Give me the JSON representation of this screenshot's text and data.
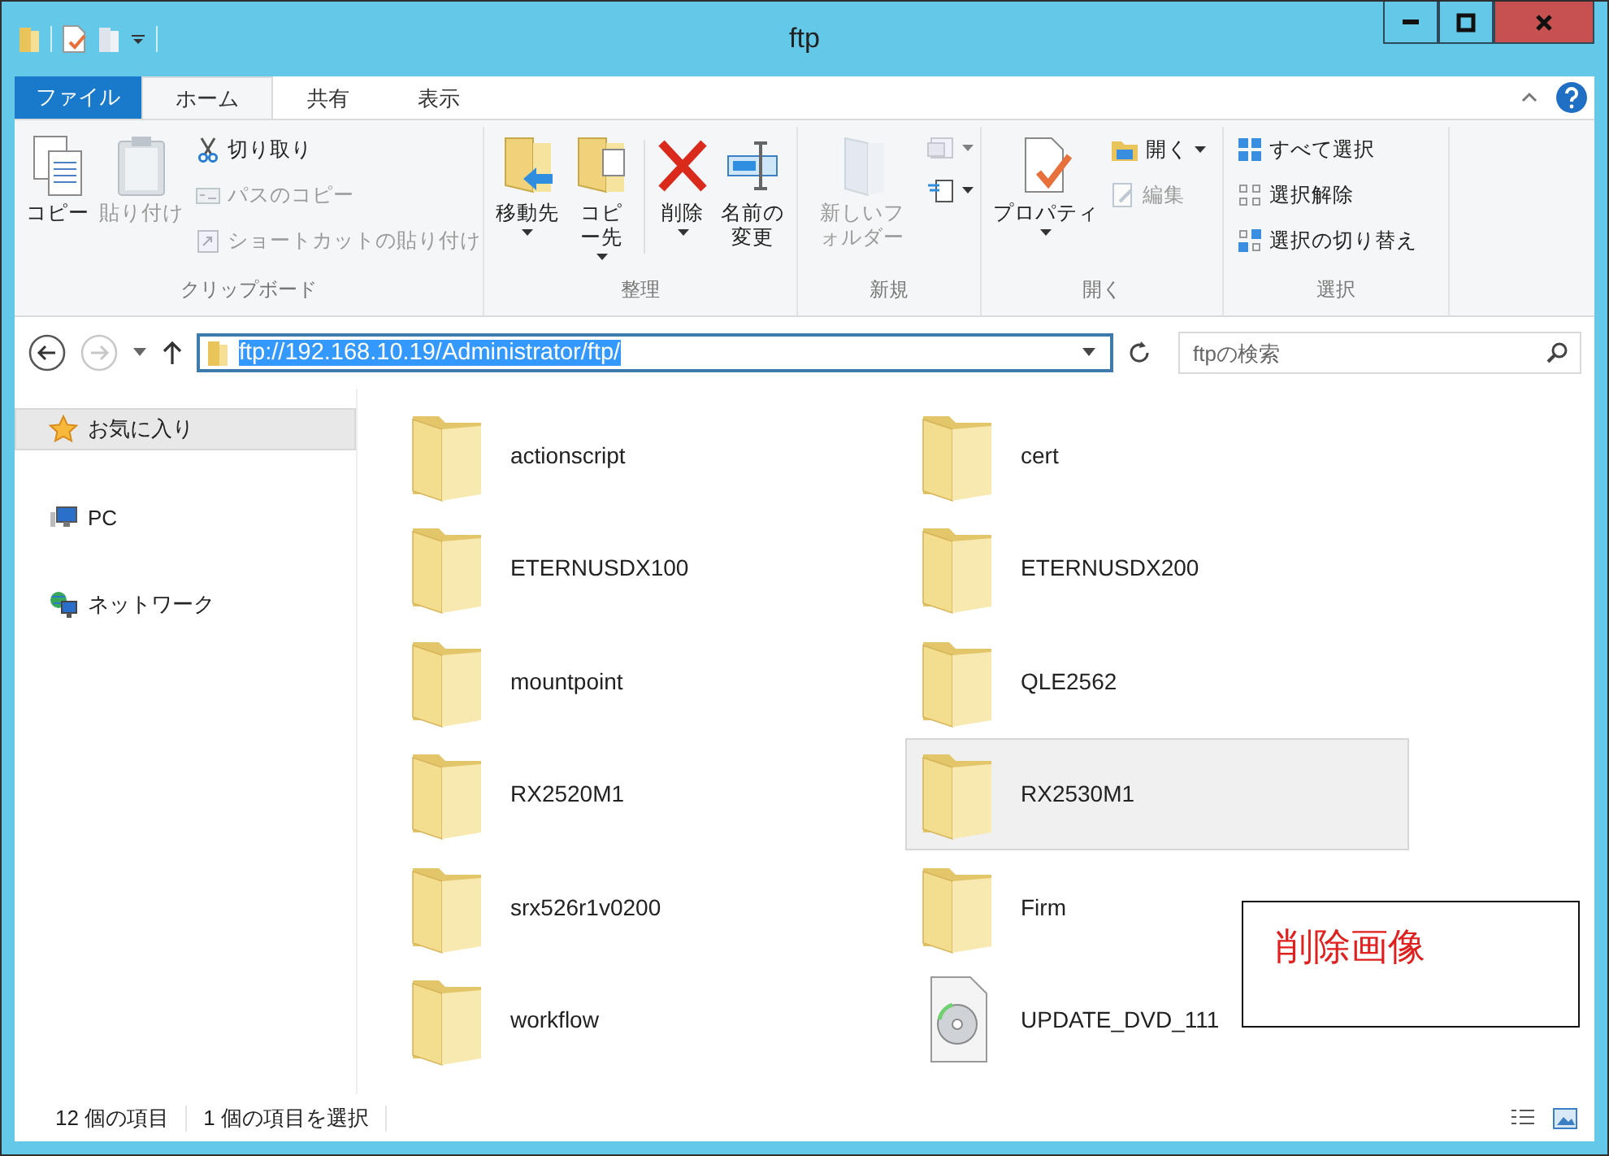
{
  "window": {
    "title": "ftp"
  },
  "ribbon_tabs": [
    {
      "label": "ファイル",
      "kind": "file",
      "selected": false
    },
    {
      "label": "ホーム",
      "kind": "tab",
      "selected": true
    },
    {
      "label": "共有",
      "kind": "tab",
      "selected": false
    },
    {
      "label": "表示",
      "kind": "tab",
      "selected": false
    }
  ],
  "ribbon_groups": [
    {
      "label": "クリップボード",
      "items": [
        {
          "kind": "large",
          "label": "コピー",
          "disabled": false,
          "dropdown": false
        },
        {
          "kind": "large",
          "label": "貼り付け",
          "disabled": true,
          "dropdown": false
        },
        {
          "kind": "small",
          "label": "切り取り",
          "disabled": false,
          "dropdown": false
        },
        {
          "kind": "small",
          "label": "パスのコピー",
          "disabled": true,
          "dropdown": false
        },
        {
          "kind": "small",
          "label": "ショートカットの貼り付け",
          "disabled": true,
          "dropdown": false
        }
      ]
    },
    {
      "label": "整理",
      "items": [
        {
          "kind": "large",
          "label": "移動先",
          "disabled": false,
          "dropdown": true
        },
        {
          "kind": "large",
          "label": "コピー先",
          "disabled": false,
          "dropdown": true
        },
        {
          "kind": "large",
          "label": "削除",
          "disabled": false,
          "dropdown": true
        },
        {
          "kind": "large",
          "label": "名前の変更",
          "disabled": false,
          "dropdown": false
        }
      ]
    },
    {
      "label": "新規",
      "items": [
        {
          "kind": "large",
          "label": "新しいフォルダー",
          "disabled": true,
          "dropdown": false
        },
        {
          "kind": "iconsmall",
          "disabled": true,
          "dropdown": true
        },
        {
          "kind": "iconsmall",
          "disabled": false,
          "dropdown": true
        }
      ]
    },
    {
      "label": "開く",
      "items": [
        {
          "kind": "large",
          "label": "プロパティ",
          "disabled": false,
          "dropdown": true
        },
        {
          "kind": "small",
          "label": "開く",
          "disabled": false,
          "dropdown": true
        },
        {
          "kind": "small",
          "label": "編集",
          "disabled": true,
          "dropdown": false
        }
      ]
    },
    {
      "label": "選択",
      "items": [
        {
          "kind": "small",
          "label": "すべて選択",
          "disabled": false,
          "dropdown": false
        },
        {
          "kind": "small",
          "label": "選択解除",
          "disabled": false,
          "dropdown": false
        },
        {
          "kind": "small",
          "label": "選択の切り替え",
          "disabled": false,
          "dropdown": false
        }
      ]
    }
  ],
  "address_bar": {
    "value": "ftp://192.168.10.19/Administrator/ftp/",
    "text_selected": true,
    "forward_disabled": true
  },
  "search": {
    "placeholder": "ftpの検索"
  },
  "navigation": [
    {
      "label": "お気に入り",
      "kind": "favorites",
      "selected": true
    },
    {
      "label": "PC",
      "kind": "pc",
      "selected": false
    },
    {
      "label": "ネットワーク",
      "kind": "network",
      "selected": false
    }
  ],
  "files": [
    {
      "name": "actionscript",
      "kind": "folder",
      "selected": false
    },
    {
      "name": "cert",
      "kind": "folder",
      "selected": false
    },
    {
      "name": "ETERNUSDX100",
      "kind": "folder",
      "selected": false
    },
    {
      "name": "ETERNUSDX200",
      "kind": "folder",
      "selected": false
    },
    {
      "name": "mountpoint",
      "kind": "folder",
      "selected": false
    },
    {
      "name": "QLE2562",
      "kind": "folder",
      "selected": false
    },
    {
      "name": "RX2520M1",
      "kind": "folder",
      "selected": false
    },
    {
      "name": "RX2530M1",
      "kind": "folder",
      "selected": true
    },
    {
      "name": "srx526r1v0200",
      "kind": "folder",
      "selected": false
    },
    {
      "name": "Firm",
      "kind": "folder",
      "selected": false
    },
    {
      "name": "workflow",
      "kind": "folder",
      "selected": false
    },
    {
      "name": "UPDATE_DVD_111",
      "kind": "disc-image",
      "selected": false
    }
  ],
  "annotation": {
    "text": "削除画像"
  },
  "status_bar": {
    "item_count": "12 個の項目",
    "selection": "1 個の項目を選択"
  }
}
